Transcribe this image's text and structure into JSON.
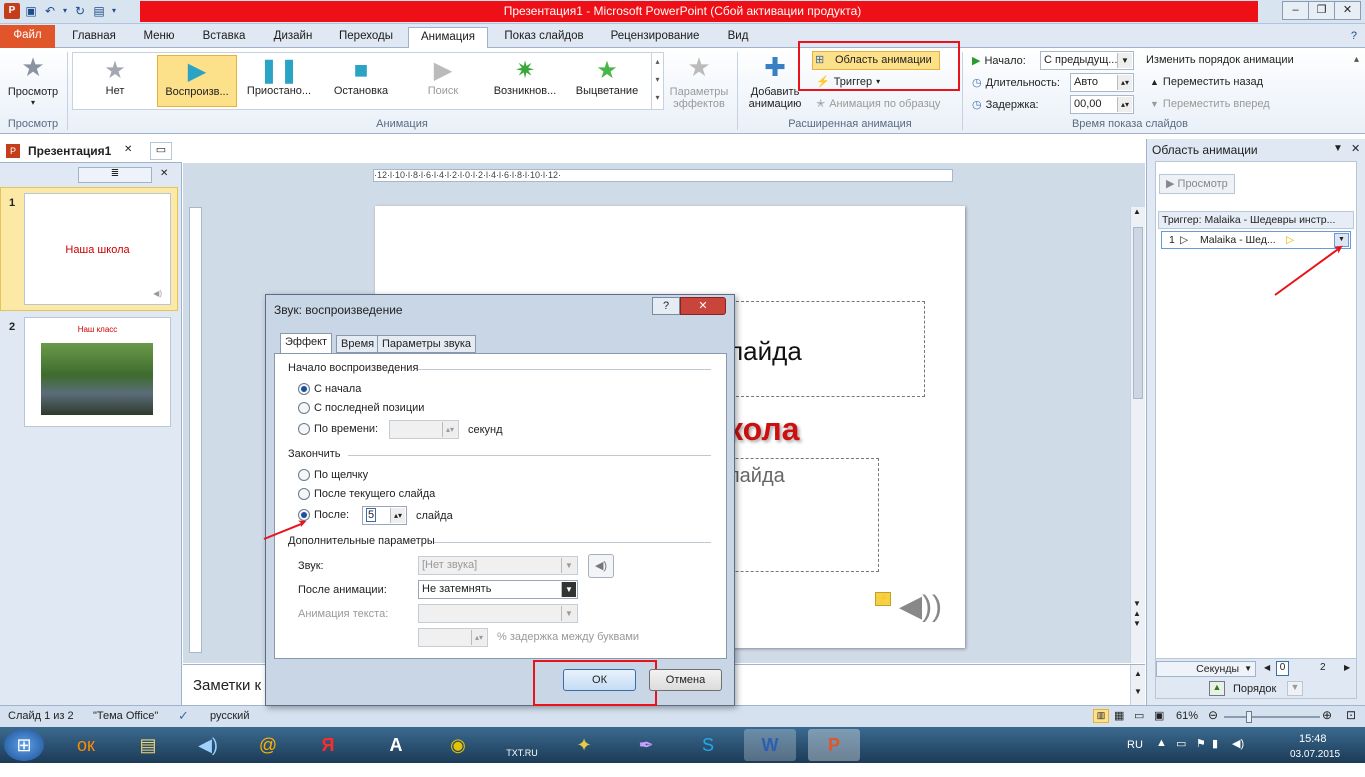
{
  "window": {
    "title": "Презентация1  -  Microsoft PowerPoint (Сбой активации продукта)"
  },
  "tabs": [
    "Файл",
    "Главная",
    "Меню",
    "Вставка",
    "Дизайн",
    "Переходы",
    "Анимация",
    "Показ слайдов",
    "Рецензирование",
    "Вид"
  ],
  "ribbon": {
    "preview_label": "Просмотр",
    "preview_group": "Просмотр",
    "animation_group": "Анимация",
    "gallery": [
      "Нет",
      "Воспроизв...",
      "Приостано...",
      "Остановка",
      "Поиск",
      "Возникнов...",
      "Выцветание"
    ],
    "effect_params_1": "Параметры",
    "effect_params_2": "эффектов",
    "add_anim_1": "Добавить",
    "add_anim_2": "анимацию",
    "anim_pane": "Область анимации",
    "trigger": "Триггер",
    "anim_painter": "Анимация по образцу",
    "ext_group": "Расширенная анимация",
    "start_label": "Начало:",
    "start_value": "С предыдущ...",
    "duration_label": "Длительность:",
    "duration_value": "Авто",
    "delay_label": "Задержка:",
    "delay_value": "00,00",
    "reorder_title": "Изменить порядок анимации",
    "move_back": "Переместить назад",
    "move_forward": "Переместить вперед",
    "timing_group": "Время показа слайдов"
  },
  "left_pane": {
    "doc_tab": "Презентация1",
    "slides": [
      {
        "num": "1",
        "title": "Наша школа"
      },
      {
        "num": "2",
        "title": "Наш класс"
      }
    ]
  },
  "editor": {
    "ruler_text": "·12·l·10·l·8·l·6·l·4·l·2·l·0·l·2·l·4·l·6·l·8·l·10·l·12·",
    "slide_text_1": "лайда",
    "slide_title": "кола",
    "slide_text_2": "лайда",
    "notes": "Заметки к"
  },
  "anim_pane": {
    "title": "Область анимации",
    "preview": "Просмотр",
    "trigger_row": "Триггер: Malaika - Шедевры инстр...",
    "item_num": "1",
    "item_label": "Malaika - Шед...",
    "seconds": "Секунды",
    "timeline_0": "0",
    "timeline_2": "2",
    "order": "Порядок"
  },
  "dialog": {
    "title": "Звук: воспроизведение",
    "tabs": [
      "Эффект",
      "Время",
      "Параметры звука"
    ],
    "start_section": "Начало воспроизведения",
    "from_start": "С начала",
    "from_last": "С последней позиции",
    "by_time": "По времени:",
    "seconds": "секунд",
    "end_section": "Закончить",
    "on_click": "По щелчку",
    "after_current": "После текущего слайда",
    "after": "После:",
    "after_value": "5",
    "slides": "слайда",
    "extra_section": "Дополнительные параметры",
    "sound_label": "Звук:",
    "sound_value": "[Нет звука]",
    "after_anim_label": "После анимации:",
    "after_anim_value": "Не затемнять",
    "text_anim_label": "Анимация текста:",
    "delay_letters": "% задержка между буквами",
    "ok": "ОК",
    "cancel": "Отмена"
  },
  "status": {
    "slide": "Слайд 1 из 2",
    "theme": "\"Тема Office\"",
    "lang": "русский",
    "zoom": "61%"
  },
  "taskbar": {
    "lang": "RU",
    "time": "15:48",
    "date": "03.07.2015",
    "txt_label": "TXT.RU"
  },
  "colors": {
    "accent_red": "#e8131b",
    "file_tab": "#e0562a",
    "slide_title_red": "#cc0000"
  }
}
